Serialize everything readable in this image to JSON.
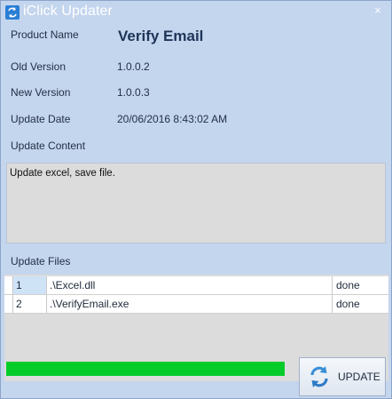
{
  "window": {
    "title": "iClick Updater",
    "close_label": "×"
  },
  "fields": {
    "product_name_label": "Product Name",
    "product_name_value": "Verify Email",
    "old_version_label": "Old Version",
    "old_version_value": "1.0.0.2",
    "new_version_label": "New Version",
    "new_version_value": "1.0.0.3",
    "update_date_label": "Update Date",
    "update_date_value": "20/06/2016 8:43:02 AM",
    "update_content_label": "Update Content",
    "update_content_value": "Update excel, save file.",
    "update_files_label": "Update Files"
  },
  "files": [
    {
      "num": "1",
      "file": ".\\Excel.dll",
      "status": "done"
    },
    {
      "num": "2",
      "file": ".\\VerifyEmail.exe",
      "status": "done"
    }
  ],
  "progress": {
    "fraction": 1.0,
    "color": "#06cc2a"
  },
  "update_button": {
    "label": "UPDATE",
    "icon": "refresh-icon"
  },
  "colors": {
    "window_bg": "#c4d5ee",
    "accent": "#2a7fd4"
  }
}
